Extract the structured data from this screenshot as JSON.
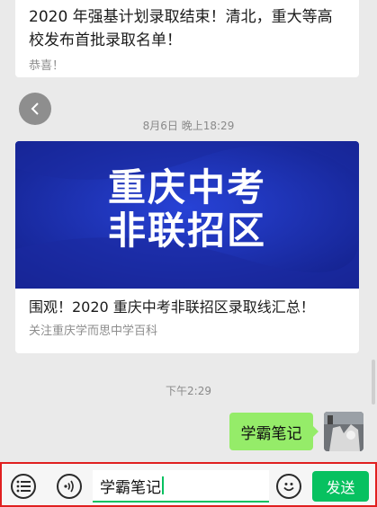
{
  "messages": {
    "article1": {
      "title": "2020 年强基计划录取结束！清北，重大等高校发布首批录取名单！",
      "desc": "恭喜！"
    },
    "timestamp1": "8月6日 晚上18:29",
    "article2": {
      "banner_line1": "重庆中考",
      "banner_line2": "非联招区",
      "title": "围观！2020 重庆中考非联招区录取线汇总！",
      "desc": "关注重庆学而思中学百科"
    },
    "timestamp2": "下午2:29",
    "sent_text": "学霸笔记"
  },
  "input": {
    "value": "学霸笔记",
    "send_label": "发送"
  },
  "colors": {
    "bubble": "#95ec69",
    "accent": "#07c160",
    "banner": "#1b2fb1",
    "highlight_border": "#e02020"
  }
}
